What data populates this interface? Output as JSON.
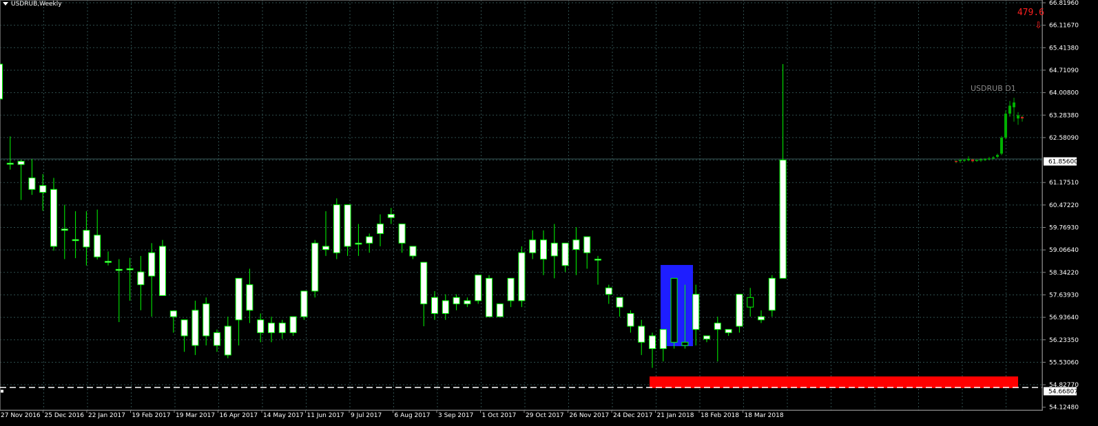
{
  "symbol_title": "USDRUB,Weekly",
  "counter_value": "479.6",
  "inset_label": "USDRUB D1",
  "icons": {
    "title": "triangle-down-icon",
    "counter": "red-down-arrow-icon"
  },
  "colors": {
    "background": "#000000",
    "grid": "#2f4f4f",
    "bull_candle": "#ffffff",
    "wick": "#00ff00",
    "highlight_box": "#1e1eff",
    "support_zone": "#ff0000",
    "price_line": "#3a5a5a",
    "text": "#ffffff",
    "counter_text": "#ff2020"
  },
  "price_axis": {
    "ticks": [
      "66.81960",
      "66.11670",
      "65.41380",
      "64.71090",
      "64.00800",
      "63.28380",
      "62.58090",
      "61.17510",
      "60.47220",
      "59.76930",
      "59.06640",
      "58.34220",
      "57.63930",
      "56.93640",
      "56.23350",
      "55.53060",
      "54.82770",
      "54.12480"
    ],
    "current_price_label": "61.85600",
    "support_price_label": "54.66807"
  },
  "time_axis": {
    "labels": [
      "27 Nov 2016",
      "25 Dec 2016",
      "22 Jan 2017",
      "19 Feb 2017",
      "19 Mar 2017",
      "16 Apr 2017",
      "14 May 2017",
      "11 Jun 2017",
      "9 Jul 2017",
      "6 Aug 2017",
      "3 Sep 2017",
      "1 Oct 2017",
      "29 Oct 2017",
      "26 Nov 2017",
      "24 Dec 2017",
      "21 Jan 2018",
      "18 Feb 2018",
      "18 Mar 2018"
    ]
  },
  "chart_data": {
    "type": "candlestick",
    "title": "USDRUB,Weekly",
    "ylim": [
      54.12,
      66.82
    ],
    "current_price": 61.856,
    "support_price": 54.66807,
    "support_zone": [
      54.67,
      54.92
    ],
    "highlighted_candles": [
      62,
      64
    ],
    "bars": [
      [
        63.81,
        65.21,
        63.2,
        64.9
      ],
      [
        61.8,
        62.64,
        61.6,
        61.8
      ],
      [
        61.76,
        61.91,
        60.65,
        61.86
      ],
      [
        60.98,
        61.93,
        60.81,
        61.34
      ],
      [
        60.89,
        61.46,
        60.31,
        61.1
      ],
      [
        59.2,
        61.34,
        59.06,
        60.98
      ],
      [
        59.7,
        60.5,
        58.8,
        59.74
      ],
      [
        59.41,
        60.3,
        58.83,
        59.41
      ],
      [
        59.18,
        60.3,
        58.6,
        59.7
      ],
      [
        58.87,
        60.35,
        58.79,
        59.55
      ],
      [
        58.73,
        59.04,
        58.6,
        58.73
      ],
      [
        58.46,
        58.8,
        56.83,
        58.48
      ],
      [
        58.5,
        58.84,
        57.5,
        58.5
      ],
      [
        58.0,
        58.9,
        57.2,
        58.4
      ],
      [
        58.27,
        59.3,
        57.0,
        59.0
      ],
      [
        57.66,
        59.4,
        57.7,
        59.2
      ],
      [
        57.0,
        57.2,
        56.5,
        57.18
      ],
      [
        56.4,
        56.9,
        55.9,
        56.9
      ],
      [
        56.1,
        57.5,
        55.8,
        57.2
      ],
      [
        56.4,
        57.6,
        56.1,
        57.4
      ],
      [
        56.1,
        56.6,
        55.9,
        56.5
      ],
      [
        55.8,
        57.0,
        55.7,
        56.7
      ],
      [
        56.9,
        57.8,
        56.1,
        58.2
      ],
      [
        57.2,
        58.5,
        56.8,
        58.0
      ],
      [
        56.5,
        57.1,
        56.2,
        56.9
      ],
      [
        56.5,
        57.0,
        56.2,
        56.8
      ],
      [
        56.5,
        56.9,
        56.3,
        56.8
      ],
      [
        56.5,
        57.0,
        56.4,
        57.0
      ],
      [
        57.0,
        57.8,
        56.9,
        57.8
      ],
      [
        57.8,
        59.4,
        57.6,
        59.3
      ],
      [
        59.1,
        60.3,
        58.9,
        59.2
      ],
      [
        59.0,
        60.7,
        58.8,
        60.5
      ],
      [
        59.2,
        60.5,
        58.9,
        60.5
      ],
      [
        59.3,
        59.9,
        58.9,
        59.3
      ],
      [
        59.3,
        59.6,
        59.0,
        59.5
      ],
      [
        59.6,
        60.2,
        59.2,
        59.9
      ],
      [
        60.1,
        60.4,
        59.9,
        60.2
      ],
      [
        59.3,
        59.9,
        59.0,
        59.9
      ],
      [
        58.9,
        59.1,
        58.8,
        59.2
      ],
      [
        57.4,
        58.7,
        56.7,
        58.7
      ],
      [
        57.1,
        57.8,
        56.9,
        57.6
      ],
      [
        57.1,
        57.7,
        56.9,
        57.5
      ],
      [
        57.4,
        57.7,
        57.2,
        57.6
      ],
      [
        57.4,
        57.6,
        57.3,
        57.5
      ],
      [
        57.5,
        58.1,
        57.4,
        58.3
      ],
      [
        57.0,
        58.3,
        57.0,
        58.2
      ],
      [
        57.0,
        57.4,
        57.0,
        57.4
      ],
      [
        57.5,
        58.2,
        57.3,
        58.2
      ],
      [
        57.5,
        59.2,
        57.3,
        59.0
      ],
      [
        59.0,
        59.7,
        58.8,
        59.4
      ],
      [
        58.8,
        59.7,
        58.3,
        59.4
      ],
      [
        58.9,
        59.9,
        58.2,
        59.3
      ],
      [
        58.6,
        59.2,
        58.4,
        59.3
      ],
      [
        59.1,
        59.8,
        58.3,
        59.4
      ],
      [
        59.0,
        59.5,
        58.5,
        59.5
      ],
      [
        58.8,
        58.9,
        58.0,
        58.8
      ],
      [
        57.7,
        58.0,
        57.4,
        57.9
      ],
      [
        57.3,
        57.5,
        57.0,
        57.6
      ],
      [
        56.7,
        57.2,
        56.5,
        57.1
      ],
      [
        56.2,
        56.9,
        55.8,
        56.7
      ],
      [
        56.0,
        56.5,
        55.4,
        56.4
      ],
      [
        56.0,
        56.6,
        55.6,
        56.6
      ],
      [
        58.2,
        58.2,
        56.0,
        56.2
      ],
      [
        56.2,
        58.0,
        56.0,
        56.1
      ],
      [
        56.6,
        58.0,
        56.1,
        57.7
      ],
      [
        56.3,
        56.4,
        56.2,
        56.4
      ],
      [
        56.6,
        57.0,
        55.6,
        56.8
      ],
      [
        56.5,
        56.6,
        56.4,
        56.6
      ],
      [
        56.7,
        57.7,
        56.5,
        57.7
      ],
      [
        57.6,
        57.9,
        57.0,
        57.3
      ],
      [
        56.9,
        57.2,
        56.8,
        57.0
      ],
      [
        57.2,
        58.3,
        57.0,
        58.2
      ],
      [
        58.2,
        64.9,
        58.2,
        61.9
      ]
    ],
    "inset_bars": [
      [
        61.87,
        61.91,
        61.8,
        61.86
      ],
      [
        61.87,
        61.94,
        61.81,
        61.9
      ],
      [
        61.9,
        61.93,
        61.84,
        61.91
      ],
      [
        61.89,
        62.02,
        61.86,
        61.94
      ],
      [
        61.92,
        61.95,
        61.82,
        61.86
      ],
      [
        61.87,
        61.93,
        61.84,
        61.9
      ],
      [
        61.9,
        61.96,
        61.84,
        61.92
      ],
      [
        61.91,
        61.96,
        61.87,
        61.93
      ],
      [
        61.93,
        62.0,
        61.9,
        61.95
      ],
      [
        61.95,
        62.02,
        61.92,
        61.98
      ],
      [
        62.0,
        62.1,
        61.96,
        62.06
      ],
      [
        62.1,
        62.65,
        62.05,
        62.6
      ],
      [
        62.6,
        63.45,
        62.55,
        63.35
      ],
      [
        63.35,
        63.75,
        63.25,
        63.6
      ],
      [
        63.55,
        63.85,
        63.1,
        63.7
      ],
      [
        63.2,
        63.4,
        63.0,
        63.3
      ],
      [
        63.25,
        63.3,
        63.1,
        63.2
      ]
    ]
  }
}
